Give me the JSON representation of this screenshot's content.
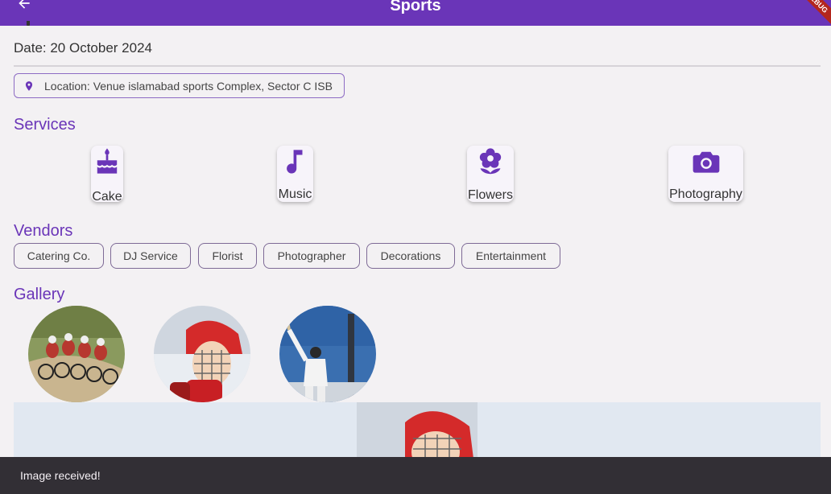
{
  "appbar": {
    "title": "Sports",
    "back_icon": "arrow-back-icon",
    "debug_label": "DEBUG"
  },
  "event": {
    "date": "Date: 20 October 2024",
    "location": "Location: Venue islamabad sports Complex, Sector C ISB"
  },
  "sections": {
    "services": "Services",
    "vendors": "Vendors",
    "gallery": "Gallery"
  },
  "services": [
    {
      "label": "Cake",
      "icon": "cake-icon"
    },
    {
      "label": "Music",
      "icon": "music-note-icon"
    },
    {
      "label": "Flowers",
      "icon": "flower-icon"
    },
    {
      "label": "Photography",
      "icon": "camera-icon"
    }
  ],
  "vendors": [
    "Catering Co.",
    "DJ Service",
    "Florist",
    "Photographer",
    "Decorations",
    "Entertainment"
  ],
  "gallery": [
    {
      "icon": "cycling-photo"
    },
    {
      "icon": "hockey-player-photo"
    },
    {
      "icon": "cricket-player-photo"
    }
  ],
  "snackbar": {
    "message": "Image received!"
  },
  "colors": {
    "primary": "#6a35b8",
    "background": "#f3f1f3",
    "snackbar": "#322f35"
  }
}
